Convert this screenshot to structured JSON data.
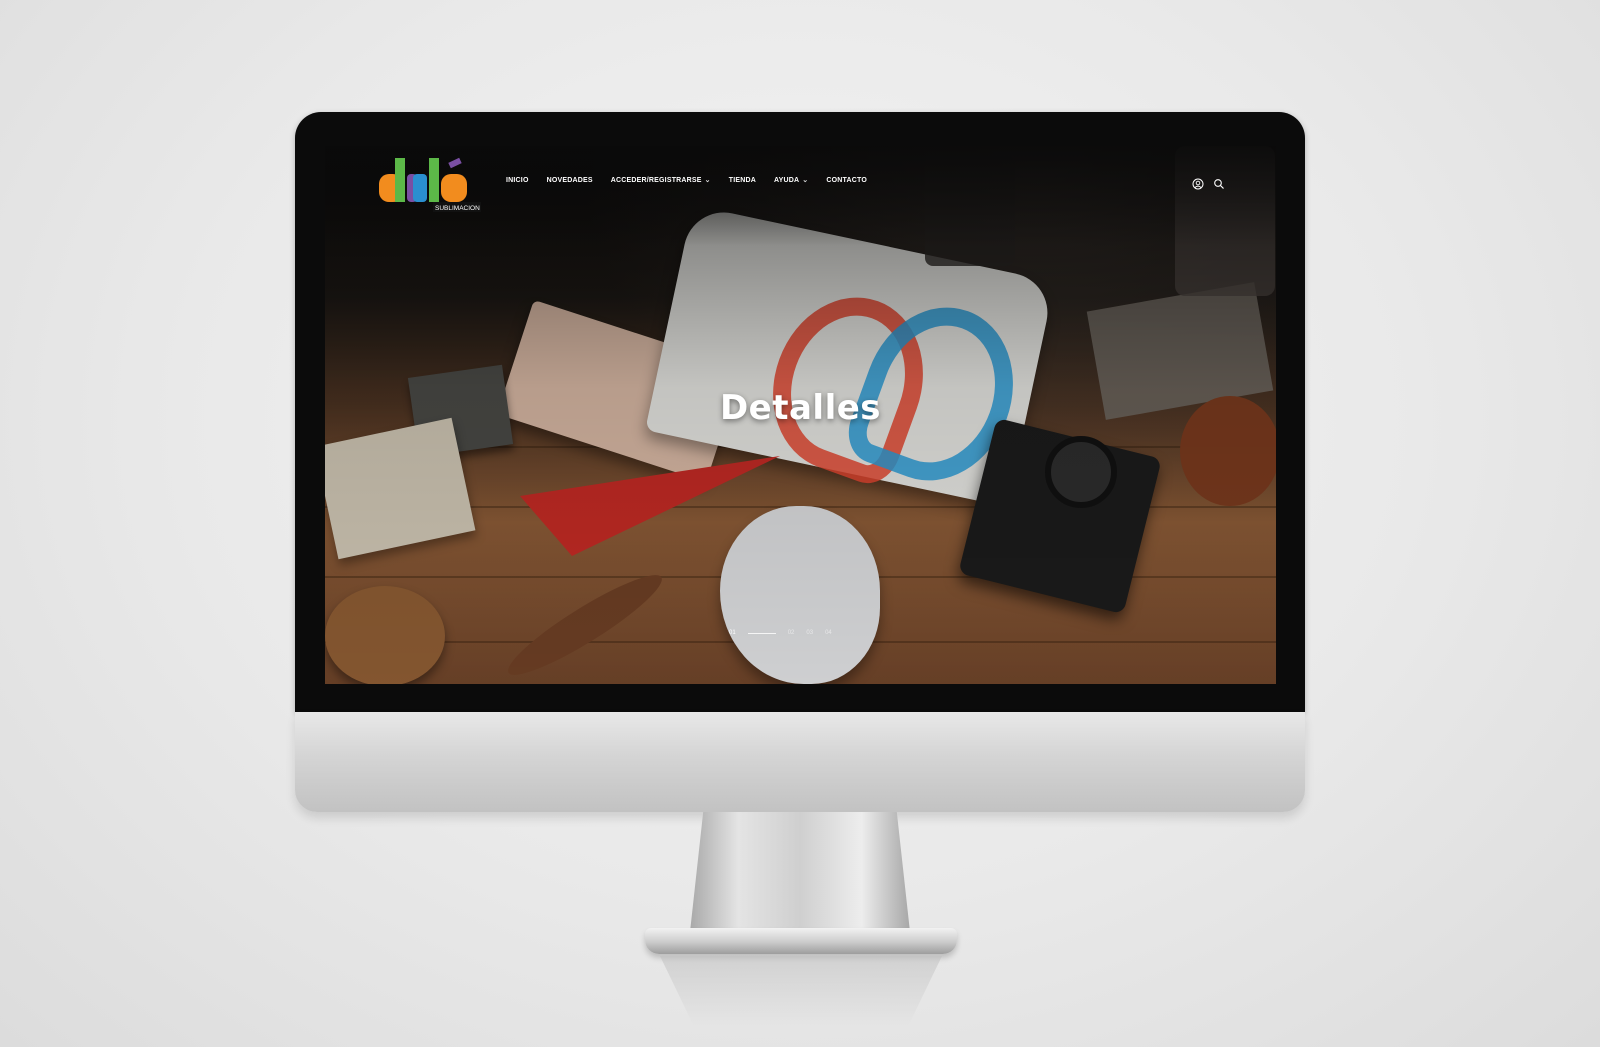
{
  "site": {
    "logo_text": "dulé",
    "logo_subtext": "SUBLIMACION"
  },
  "nav": {
    "items": [
      {
        "label": "INICIO",
        "has_dropdown": false
      },
      {
        "label": "NOVEDADES",
        "has_dropdown": false
      },
      {
        "label": "ACCEDER/REGISTRARSE",
        "has_dropdown": true
      },
      {
        "label": "TIENDA",
        "has_dropdown": false
      },
      {
        "label": "AYUDA",
        "has_dropdown": true
      },
      {
        "label": "CONTACTO",
        "has_dropdown": false
      }
    ],
    "dropdown_glyph": "⌄"
  },
  "header_icons": [
    "user-icon",
    "search-icon"
  ],
  "hero": {
    "title": "Detalles"
  },
  "slider": {
    "slides": [
      "01",
      "02",
      "03",
      "04"
    ],
    "active_index": 0
  },
  "colors": {
    "header_text": "#ffffff",
    "logo_orange": "#f28c1e",
    "logo_green": "#5cb848",
    "logo_purple": "#7a4fa3",
    "logo_blue": "#2a8fd0"
  }
}
